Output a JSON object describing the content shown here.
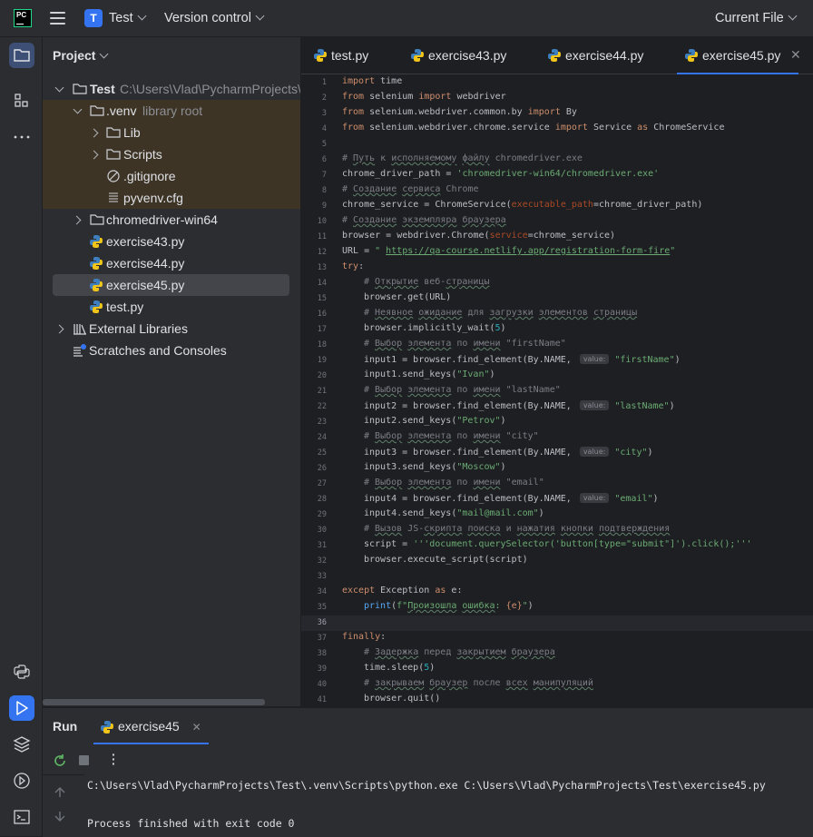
{
  "topbar": {
    "logo_text": "PC",
    "project_initial": "T",
    "project_name": "Test",
    "vcs_label": "Version control",
    "run_config": "Current File"
  },
  "project_panel": {
    "title": "Project",
    "root_name": "Test",
    "root_path": "C:\\Users\\Vlad\\PycharmProjects\\",
    "venv_name": ".venv",
    "venv_note": "library root",
    "items": {
      "lib": "Lib",
      "scripts": "Scripts",
      "gitignore": ".gitignore",
      "pyvenv": "pyvenv.cfg",
      "chromedriver": "chromedriver-win64",
      "ex43": "exercise43.py",
      "ex44": "exercise44.py",
      "ex45": "exercise45.py",
      "test": "test.py",
      "ext_libs": "External Libraries",
      "scratches": "Scratches and Consoles"
    }
  },
  "tabs": [
    "test.py",
    "exercise43.py",
    "exercise44.py",
    "exercise45.py"
  ],
  "active_tab": "exercise45.py",
  "editor": {
    "line_numbers": [
      "1",
      "2",
      "3",
      "4",
      "5",
      "6",
      "7",
      "8",
      "9",
      "10",
      "11",
      "12",
      "13",
      "14",
      "15",
      "16",
      "17",
      "18",
      "19",
      "20",
      "21",
      "22",
      "23",
      "24",
      "25",
      "26",
      "27",
      "28",
      "29",
      "30",
      "31",
      "32",
      "33",
      "34",
      "35",
      "36",
      "37",
      "38",
      "39",
      "40",
      "41"
    ],
    "current_line": 36,
    "hint_label": "value:",
    "code": {
      "l1_kw": "import",
      "l1_rest": " time",
      "l2_kw1": "from",
      "l2_mod": " selenium ",
      "l2_kw2": "import",
      "l2_rest": " webdriver",
      "l3_kw1": "from",
      "l3_mod": " selenium.webdriver.common.by ",
      "l3_kw2": "import",
      "l3_rest": " By",
      "l4_kw1": "from",
      "l4_mod": " selenium.webdriver.chrome.service ",
      "l4_kw2": "import",
      "l4_mid": " Service ",
      "l4_kw3": "as",
      "l4_rest": " ChromeService",
      "l6_hash": "# ",
      "l6_ru1": "Путь",
      "l6_k": " к ",
      "l6_ru2": "исполняемому",
      "l6_sp": " ",
      "l6_ru3": "файлу",
      "l6_end": " chromedriver.exe",
      "l7_a": "chrome_driver_path = ",
      "l7_s": "'chromedriver-win64/chromedriver.exe'",
      "l8_hash": "# ",
      "l8_ru1": "Создание",
      "l8_sp": " ",
      "l8_ru2": "сервиса",
      "l8_end": " Chrome",
      "l9_a": "chrome_service = ChromeService(",
      "l9_p": "executable_path",
      "l9_b": "=chrome_driver_path)",
      "l10_hash": "# ",
      "l10_ru1": "Создание",
      "l10_sp": " ",
      "l10_ru2": "экземпляра",
      "l10_sp2": " ",
      "l10_ru3": "браузера",
      "l11_a": "browser = webdriver.Chrome(",
      "l11_p": "service",
      "l11_b": "=chrome_service)",
      "l12_a": "URL = ",
      "l12_q": "\" ",
      "l12_url": "https://qa-course.netlify.app/registration-form-fire",
      "l12_q2": "\"",
      "l13_kw": "try",
      "l13_rest": ":",
      "l14_hash": "# ",
      "l14_ru1": "Открытие",
      "l14_mid": " веб-",
      "l14_ru2": "страницы",
      "l15": "browser.get(URL)",
      "l16_hash": "# ",
      "l16_ru1": "Неявное",
      "l16_sp": " ",
      "l16_ru2": "ожидание",
      "l16_mid": " для ",
      "l16_ru3": "загрузки",
      "l16_sp2": " ",
      "l16_ru4": "элементов",
      "l16_sp3": " ",
      "l16_ru5": "страницы",
      "l17_a": "browser.implicitly_wait(",
      "l17_n": "5",
      "l17_b": ")",
      "l18_hash": "# ",
      "l18_ru1": "Выбор",
      "l18_sp": " ",
      "l18_ru2": "элемента",
      "l18_mid": " по ",
      "l18_ru3": "имени",
      "l18_end": " \"firstName\"",
      "l19_a": "input1 = browser.find_element(By.NAME, ",
      "l19_s": "\"firstName\"",
      "l19_b": ")",
      "l20_a": "input1.send_keys(",
      "l20_s": "\"Ivan\"",
      "l20_b": ")",
      "l21_hash": "# ",
      "l21_ru1": "Выбор",
      "l21_sp": " ",
      "l21_ru2": "элемента",
      "l21_mid": " по ",
      "l21_ru3": "имени",
      "l21_end": " \"lastName\"",
      "l22_a": "input2 = browser.find_element(By.NAME, ",
      "l22_s": "\"lastName\"",
      "l22_b": ")",
      "l23_a": "input2.send_keys(",
      "l23_s": "\"Petrov\"",
      "l23_b": ")",
      "l24_hash": "# ",
      "l24_ru1": "Выбор",
      "l24_sp": " ",
      "l24_ru2": "элемента",
      "l24_mid": " по ",
      "l24_ru3": "имени",
      "l24_end": " \"city\"",
      "l25_a": "input3 = browser.find_element(By.NAME, ",
      "l25_s": "\"city\"",
      "l25_b": ")",
      "l26_a": "input3.send_keys(",
      "l26_s": "\"Moscow\"",
      "l26_b": ")",
      "l27_hash": "# ",
      "l27_ru1": "Выбор",
      "l27_sp": " ",
      "l27_ru2": "элемента",
      "l27_mid": " по ",
      "l27_ru3": "имени",
      "l27_end": " \"email\"",
      "l28_a": "input4 = browser.find_element(By.NAME, ",
      "l28_s": "\"email\"",
      "l28_b": ")",
      "l29_a": "input4.send_keys(",
      "l29_s": "\"mail@mail.com\"",
      "l29_b": ")",
      "l30_hash": "# ",
      "l30_ru1": "Вызов",
      "l30_mid": " JS-",
      "l30_ru2": "скрипта",
      "l30_sp": " ",
      "l30_ru3": "поиска",
      "l30_mid2": " и ",
      "l30_ru4": "нажатия",
      "l30_sp2": " ",
      "l30_ru5": "кнопки",
      "l30_sp3": " ",
      "l30_ru6": "подтверждения",
      "l31_a": "script = ",
      "l31_s": "'''document.querySelector('button[type=\"submit\"]').click();'''",
      "l32": "browser.execute_script(script)",
      "l34_kw": "except",
      "l34_mid": " Exception ",
      "l34_kw2": "as",
      "l34_rest": " e:",
      "l35_fn": "print",
      "l35_a": "(",
      "l35_s1": "f\"",
      "l35_ru1": "Произошла",
      "l35_sp": " ",
      "l35_ru2": "ошибка",
      "l35_s2": ": ",
      "l35_brace": "{e}",
      "l35_s3": "\"",
      "l35_b": ")",
      "l37_kw": "finally",
      "l37_rest": ":",
      "l38_hash": "# ",
      "l38_ru1": "Задержка",
      "l38_mid": " перед ",
      "l38_ru2": "закрытием",
      "l38_sp": " ",
      "l38_ru3": "браузера",
      "l39_a": "time.sleep(",
      "l39_n": "5",
      "l39_b": ")",
      "l40_hash": "# ",
      "l40_ru1": "закрываем",
      "l40_sp": " ",
      "l40_ru2": "браузер",
      "l40_mid": " после ",
      "l40_ru3": "всех",
      "l40_sp2": " ",
      "l40_ru4": "манипуляций",
      "l41": "browser.quit()"
    }
  },
  "run_panel": {
    "title": "Run",
    "tab": "exercise45",
    "console_cmd": "C:\\Users\\Vlad\\PycharmProjects\\Test\\.venv\\Scripts\\python.exe C:\\Users\\Vlad\\PycharmProjects\\Test\\exercise45.py",
    "console_exit": "Process finished with exit code 0"
  },
  "colors": {
    "accent": "#3574f0",
    "keyword": "#cf8e6d",
    "string": "#6aab73",
    "comment": "#7a7e85",
    "number": "#2aacb8"
  }
}
